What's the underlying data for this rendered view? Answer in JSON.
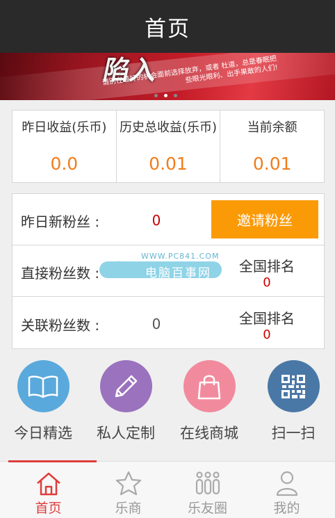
{
  "header": {
    "title": "首页"
  },
  "banner": {
    "headline": "陷入",
    "tagline": "请别在最好的机会面前选择放弃，或者 杜道，总是春眠把些眼光眼利、出手果敢的人们!",
    "slides": 3,
    "active_slide": 2
  },
  "stats": [
    {
      "label": "昨日收益(乐币)",
      "value": "0.0"
    },
    {
      "label": "历史总收益(乐币)",
      "value": "0.01"
    },
    {
      "label": "当前余额",
      "value": "0.01"
    }
  ],
  "fans": {
    "yesterday_label": "昨日新粉丝 :",
    "yesterday_value": "0",
    "invite_label": "邀请粉丝",
    "direct_label": "直接粉丝数 :",
    "direct_rank_label": "全国排名",
    "direct_rank_value": "0",
    "related_label": "关联粉丝数 :",
    "related_value": "0",
    "related_rank_label": "全国排名",
    "related_rank_value": "0"
  },
  "watermark": {
    "url": "WWW.PC841.COM",
    "name": "电脑百事网"
  },
  "quick_actions": [
    {
      "label": "今日精选",
      "icon": "book-icon",
      "color": "#5aa9dc"
    },
    {
      "label": "私人定制",
      "icon": "pencil-icon",
      "color": "#9b72be"
    },
    {
      "label": "在线商城",
      "icon": "shopping-bag-icon",
      "color": "#f28a9d"
    },
    {
      "label": "扫一扫",
      "icon": "qr-code-icon",
      "color": "#4a78a6"
    }
  ],
  "tabs": [
    {
      "label": "首页",
      "icon": "home-icon",
      "active": true
    },
    {
      "label": "乐商",
      "icon": "star-icon",
      "active": false
    },
    {
      "label": "乐友圈",
      "icon": "people-icon",
      "active": false
    },
    {
      "label": "我的",
      "icon": "user-icon",
      "active": false
    }
  ],
  "colors": {
    "accent": "#fb9a07",
    "value_orange": "#f07d1c",
    "rank_red": "#cc0000",
    "tab_active": "#e03c3c",
    "titlebar": "#2a2a2a"
  }
}
